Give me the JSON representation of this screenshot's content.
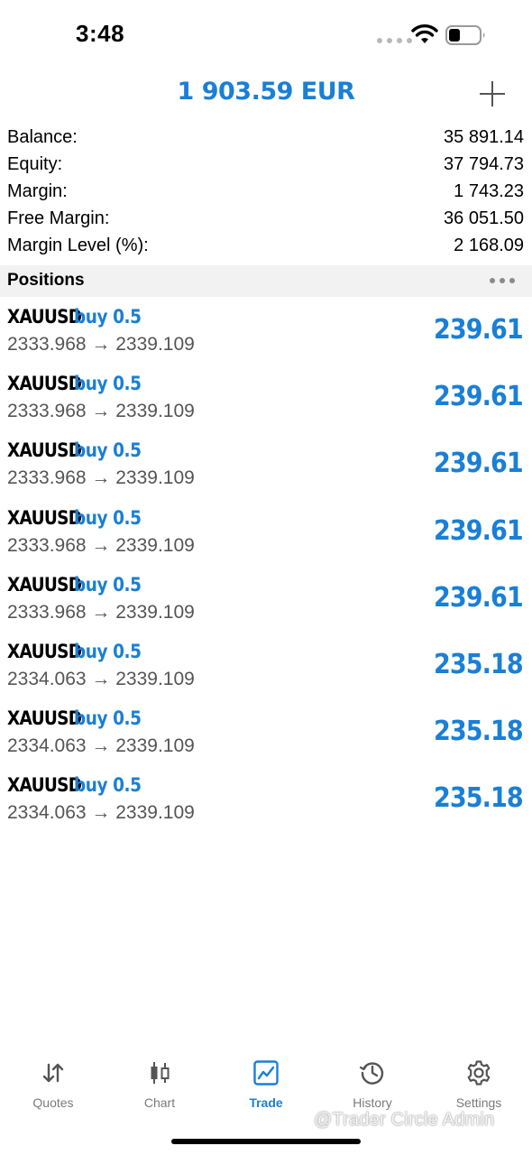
{
  "status_bar": {
    "time": "3:48"
  },
  "header": {
    "title": "1 903.59 EUR",
    "add_icon": "plus-icon"
  },
  "summary": [
    {
      "label": "Balance:",
      "value": "35 891.14"
    },
    {
      "label": "Equity:",
      "value": "37 794.73"
    },
    {
      "label": "Margin:",
      "value": "1 743.23"
    },
    {
      "label": "Free Margin:",
      "value": "36 051.50"
    },
    {
      "label": "Margin Level (%):",
      "value": "2 168.09"
    }
  ],
  "positions": {
    "title": "Positions",
    "items": [
      {
        "symbol": "XAUUSD",
        "side": "buy 0.5",
        "prices": "2333.968 → 2339.109",
        "profit": "239.61"
      },
      {
        "symbol": "XAUUSD",
        "side": "buy 0.5",
        "prices": "2333.968 → 2339.109",
        "profit": "239.61"
      },
      {
        "symbol": "XAUUSD",
        "side": "buy 0.5",
        "prices": "2333.968 → 2339.109",
        "profit": "239.61"
      },
      {
        "symbol": "XAUUSD",
        "side": "buy 0.5",
        "prices": "2333.968 → 2339.109",
        "profit": "239.61"
      },
      {
        "symbol": "XAUUSD",
        "side": "buy 0.5",
        "prices": "2333.968 → 2339.109",
        "profit": "239.61"
      },
      {
        "symbol": "XAUUSD",
        "side": "buy 0.5",
        "prices": "2334.063 → 2339.109",
        "profit": "235.18"
      },
      {
        "symbol": "XAUUSD",
        "side": "buy 0.5",
        "prices": "2334.063 → 2339.109",
        "profit": "235.18"
      },
      {
        "symbol": "XAUUSD",
        "side": "buy 0.5",
        "prices": "2334.063 → 2339.109",
        "profit": "235.18"
      }
    ]
  },
  "tabs": [
    {
      "label": "Quotes",
      "icon": "sort-arrows-icon",
      "active": false
    },
    {
      "label": "Chart",
      "icon": "candlestick-icon",
      "active": false
    },
    {
      "label": "Trade",
      "icon": "trade-chart-icon",
      "active": true
    },
    {
      "label": "History",
      "icon": "history-clock-icon",
      "active": false
    },
    {
      "label": "Settings",
      "icon": "gear-icon",
      "active": false
    }
  ],
  "watermark": "@Trader Circle Admin",
  "colors": {
    "accent": "#1a7fd6",
    "section_bg": "#f2f2f2",
    "inactive_tab": "#7a7a7a"
  }
}
